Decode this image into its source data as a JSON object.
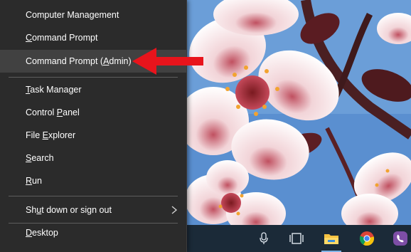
{
  "menu": {
    "items": [
      {
        "label": "Computer Management",
        "mnemonic": "g"
      },
      {
        "label": "Command Prompt",
        "mnemonic": "C"
      },
      {
        "label": "Command Prompt (Admin)",
        "mnemonic": "A"
      },
      {
        "label": "Task Manager",
        "mnemonic": "T"
      },
      {
        "label": "Control Panel",
        "mnemonic": "P"
      },
      {
        "label": "File Explorer",
        "mnemonic": "E"
      },
      {
        "label": "Search",
        "mnemonic": "S"
      },
      {
        "label": "Run",
        "mnemonic": "R"
      },
      {
        "label": "Shut down or sign out",
        "mnemonic": "u"
      },
      {
        "label": "Desktop",
        "mnemonic": "D"
      }
    ],
    "highlighted_item": "Command Prompt (Admin)"
  },
  "annotation": {
    "type": "red-arrow",
    "points_to": "Command Prompt (Admin)",
    "color": "#e8141c"
  },
  "taskbar": {
    "icons": [
      "microphone-icon",
      "task-view-icon",
      "file-explorer-icon",
      "chrome-icon",
      "viber-icon"
    ]
  },
  "colors": {
    "menu_background": "#2b2b2b",
    "menu_highlight": "#414141",
    "menu_text": "#ffffff",
    "separator": "#5e5e5e",
    "taskbar": "#1b2a38"
  }
}
